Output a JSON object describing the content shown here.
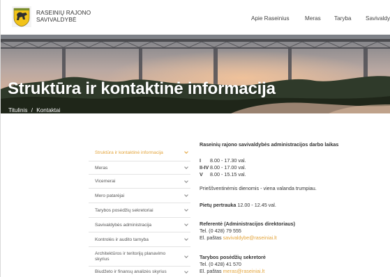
{
  "header": {
    "brand_line1": "RASEINIŲ RAJONO",
    "brand_line2": "SAVIVALDYBĖ",
    "nav": [
      "Apie Raseinius",
      "Meras",
      "Taryba",
      "Savivaldybė"
    ]
  },
  "hero": {
    "title": "Struktūra ir kontaktinė informacija",
    "breadcrumb": [
      "Titulinis",
      "/",
      "Kontaktai"
    ]
  },
  "sidebar": {
    "items": [
      {
        "label": "Struktūra ir kontaktinė informacija",
        "active": true
      },
      {
        "label": "Meras"
      },
      {
        "label": "Vicemerai"
      },
      {
        "label": "Mero patarėjai"
      },
      {
        "label": "Tarybos posėdžių sekretoriai"
      },
      {
        "label": "Savivaldybės administracija"
      },
      {
        "label": "Kontrolės ir audito tarnyba"
      },
      {
        "label": "Architektūros ir teritorijų planavimo skyrius"
      },
      {
        "label": "Biudžeto ir finansų analizės skyrius"
      }
    ]
  },
  "content": {
    "hours_title": "Raseinių rajono savivaldybės administracijos darbo laikas",
    "hours": [
      {
        "day": "I",
        "time": "8.00 - 17.30 val."
      },
      {
        "day": "II-IV",
        "time": "8.00 - 17.00 val."
      },
      {
        "day": "V",
        "time": "8.00 - 15.15 val."
      }
    ],
    "holiday_note": "Prieššventinėmis dienomis - viena valanda trumpiau.",
    "lunch_label": "Pietų pertrauka",
    "lunch_time": "12.00 - 12.45 val.",
    "contact1_title": "Referentė (Administracijos direktoriaus)",
    "contact1_tel": "Tel. (0 428)  79 555",
    "contact1_email_label": "El. paštas",
    "contact1_email": "savivaldybe@raseiniai.lt",
    "contact2_title": "Tarybos posėdžių sekretorė",
    "contact2_tel": "Tel. (0 428)  41 570",
    "contact2_email_label": "El. paštas",
    "contact2_email": "meras@raseiniai.lt"
  },
  "colors": {
    "accent": "#e3a43b",
    "text": "#333333",
    "border": "#e3e3e3"
  }
}
